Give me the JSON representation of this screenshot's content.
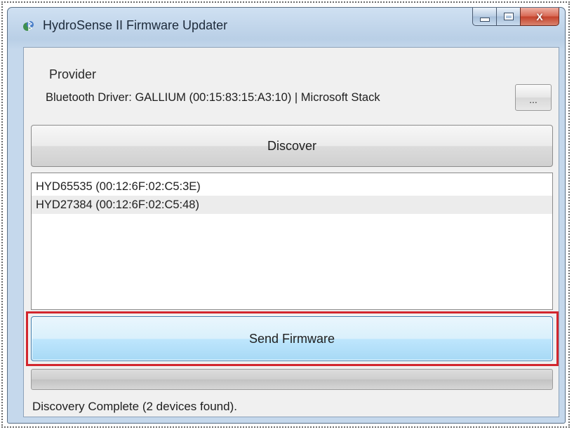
{
  "window": {
    "title": "HydroSense II Firmware Updater",
    "icon": "bluetooth-app-icon",
    "controls": {
      "minimize": "minimize-icon",
      "maximize": "maximize-icon",
      "close_label": "X"
    }
  },
  "provider": {
    "label": "Provider",
    "value": "Bluetooth Driver: GALLIUM (00:15:83:15:A3:10) | Microsoft Stack",
    "browse_label": "..."
  },
  "discover": {
    "label": "Discover"
  },
  "devices": [
    {
      "label": "HYD65535 (00:12:6F:02:C5:3E)"
    },
    {
      "label": "HYD27384 (00:12:6F:02:C5:48)"
    }
  ],
  "send_firmware": {
    "label": "Send Firmware",
    "highlight_color": "#d2262e"
  },
  "progress": {
    "value_percent": 0
  },
  "status": {
    "text": "Discovery Complete (2 devices found)."
  }
}
